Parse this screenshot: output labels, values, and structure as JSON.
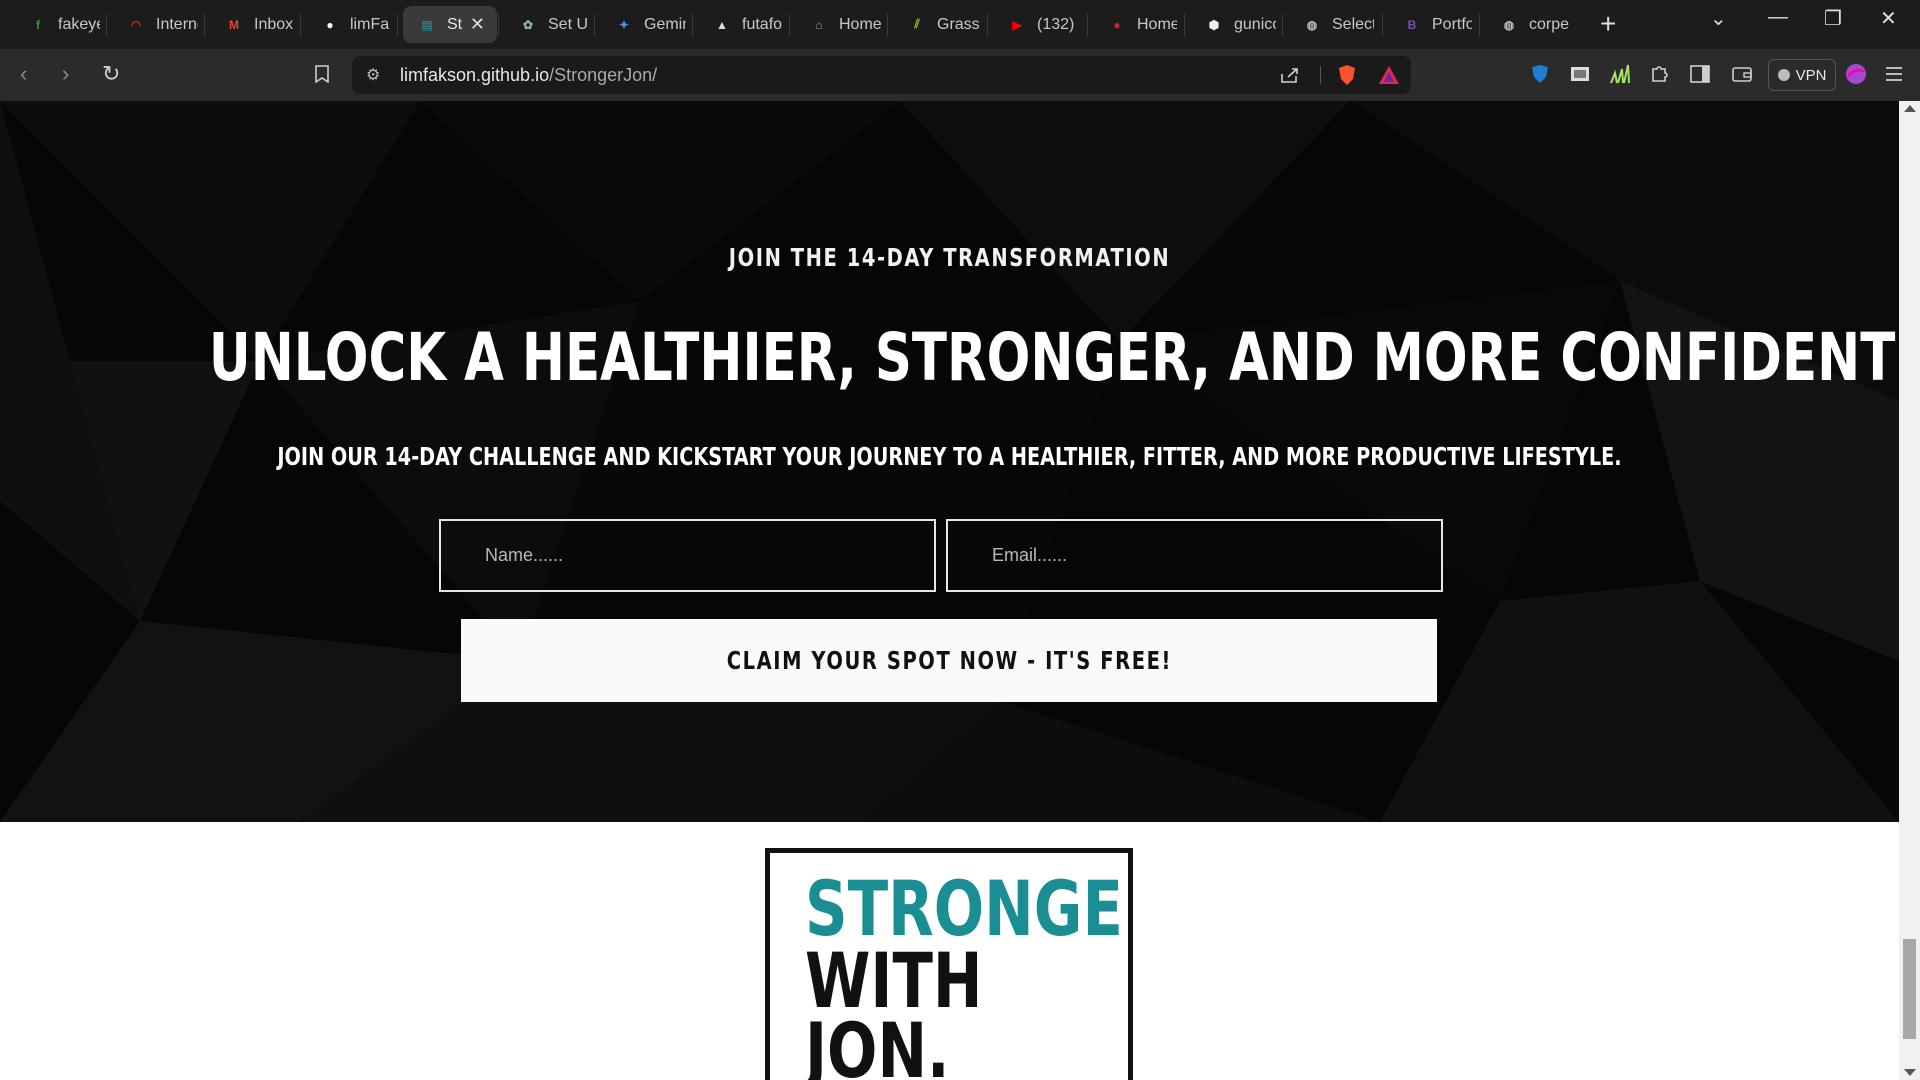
{
  "browser": {
    "tabs": [
      {
        "label": "fakeye",
        "icon": "fakeyou-icon",
        "color": "#2ea043"
      },
      {
        "label": "Interne",
        "icon": "speed-gauge-icon",
        "color": "#e02b2b"
      },
      {
        "label": "Inbox (",
        "icon": "gmail-icon",
        "color": "#ea4335"
      },
      {
        "label": "limFak",
        "icon": "github-icon",
        "color": "#ffffff"
      },
      {
        "label": "St",
        "icon": "site-favicon-icon",
        "color": "#2c7a7b",
        "active": true
      },
      {
        "label": "Set Us",
        "icon": "chatgpt-icon",
        "color": "#8fb8a8"
      },
      {
        "label": "Gemin",
        "icon": "gemini-icon",
        "color": "#4c8df6"
      },
      {
        "label": "futafo",
        "icon": "triangle-logo-icon",
        "color": "#dddddd"
      },
      {
        "label": "Home",
        "icon": "home-favicon-icon",
        "color": "#8899aa"
      },
      {
        "label": "Grass",
        "icon": "grass-icon",
        "color": "#7ed321"
      },
      {
        "label": "(132) (",
        "icon": "youtube-icon",
        "color": "#ff0000"
      },
      {
        "label": "Home",
        "icon": "home-red-icon",
        "color": "#cc2222"
      },
      {
        "label": "gunico",
        "icon": "gunicorn-icon",
        "color": "#eeeeee"
      },
      {
        "label": "Select",
        "icon": "globe-icon",
        "color": "#bbbbbb"
      },
      {
        "label": "Portfo",
        "icon": "bootstrap-icon",
        "color": "#7952b3"
      },
      {
        "label": "corpe",
        "icon": "globe-icon",
        "color": "#bbbbbb"
      }
    ],
    "new_tab": "+",
    "url_site": "limfakson.github.io",
    "url_path": "/StrongerJon/",
    "vpn_label": "VPN"
  },
  "hero": {
    "eyebrow": "JOIN THE 14-DAY TRANSFORMATION",
    "headline": "UNLOCK A HEALTHIER, STRONGER, AND MORE CONFIDENT YOU",
    "subline": "JOIN OUR 14-DAY CHALLENGE AND KICKSTART YOUR JOURNEY TO A HEALTHIER, FITTER, AND MORE PRODUCTIVE LIFESTYLE.",
    "name_placeholder": "Name......",
    "email_placeholder": "Email......",
    "cta_label": "CLAIM YOUR SPOT NOW - IT'S FREE!"
  },
  "logo": {
    "line1": "STRONGER",
    "line2": "WITH",
    "line3": "JON.",
    "accent_color": "#1b8e93"
  }
}
